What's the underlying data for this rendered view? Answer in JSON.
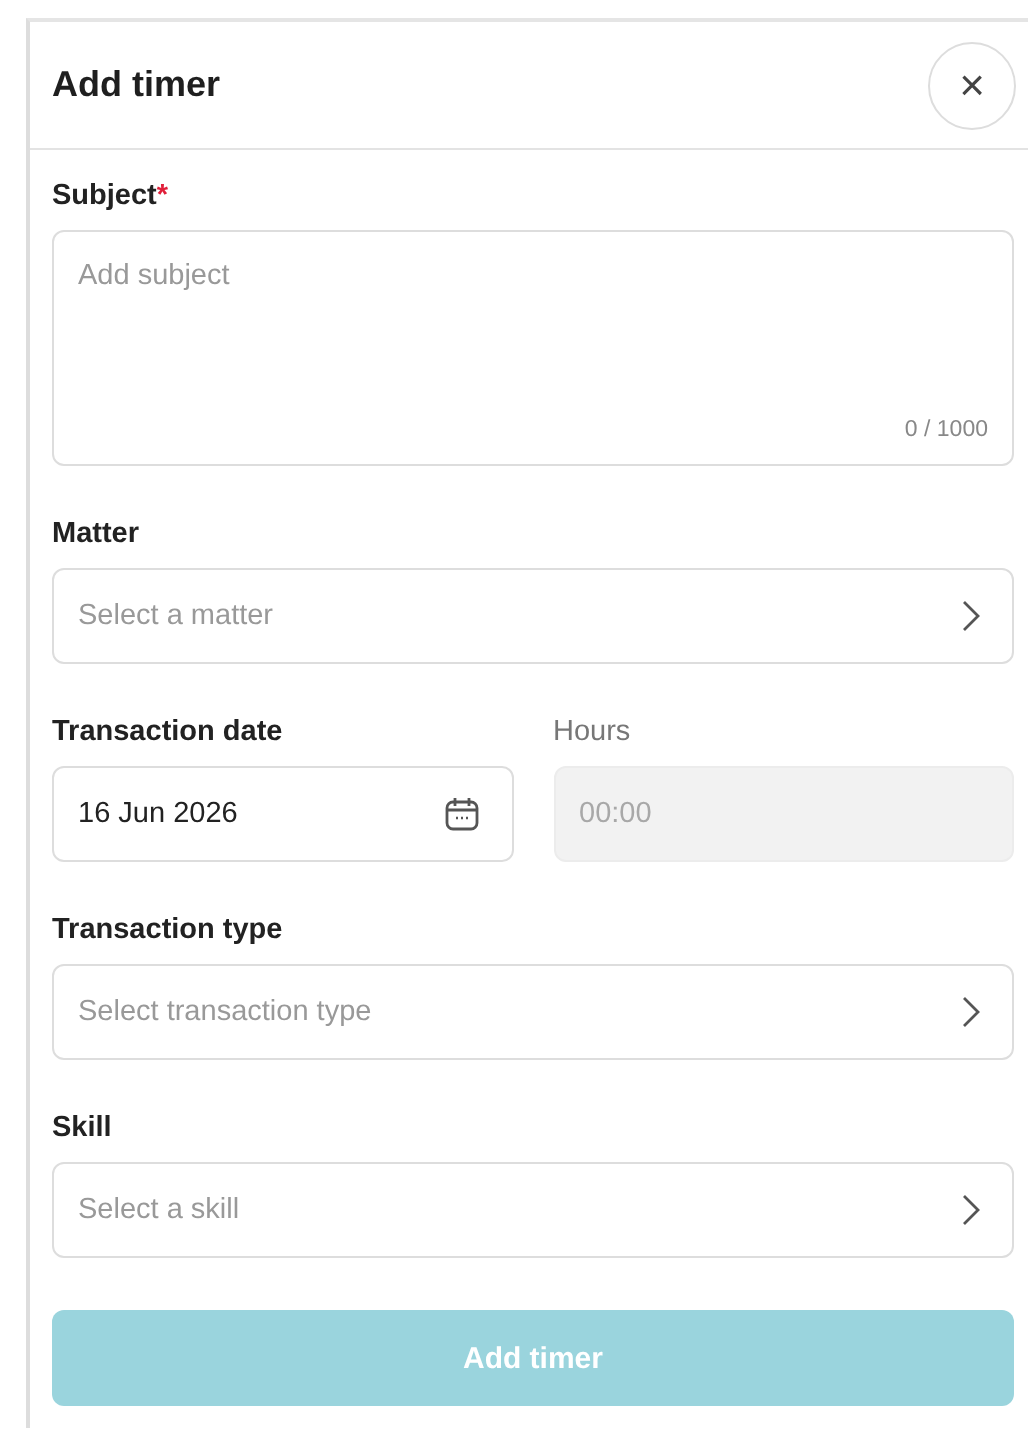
{
  "panel": {
    "title": "Add timer",
    "close": "×"
  },
  "subject": {
    "label": "Subject",
    "required_mark": "*",
    "placeholder": "Add subject",
    "counter": "0 / 1000"
  },
  "matter": {
    "label": "Matter",
    "placeholder": "Select a matter"
  },
  "transaction_date": {
    "label": "Transaction date",
    "value": "16 Jun 2026"
  },
  "hours": {
    "label": "Hours",
    "placeholder": "00:00",
    "disabled": true
  },
  "transaction_type": {
    "label": "Transaction type",
    "placeholder": "Select transaction type"
  },
  "skill": {
    "label": "Skill",
    "placeholder": "Select a skill"
  },
  "submit": {
    "label": "Add timer",
    "disabled": true
  }
}
